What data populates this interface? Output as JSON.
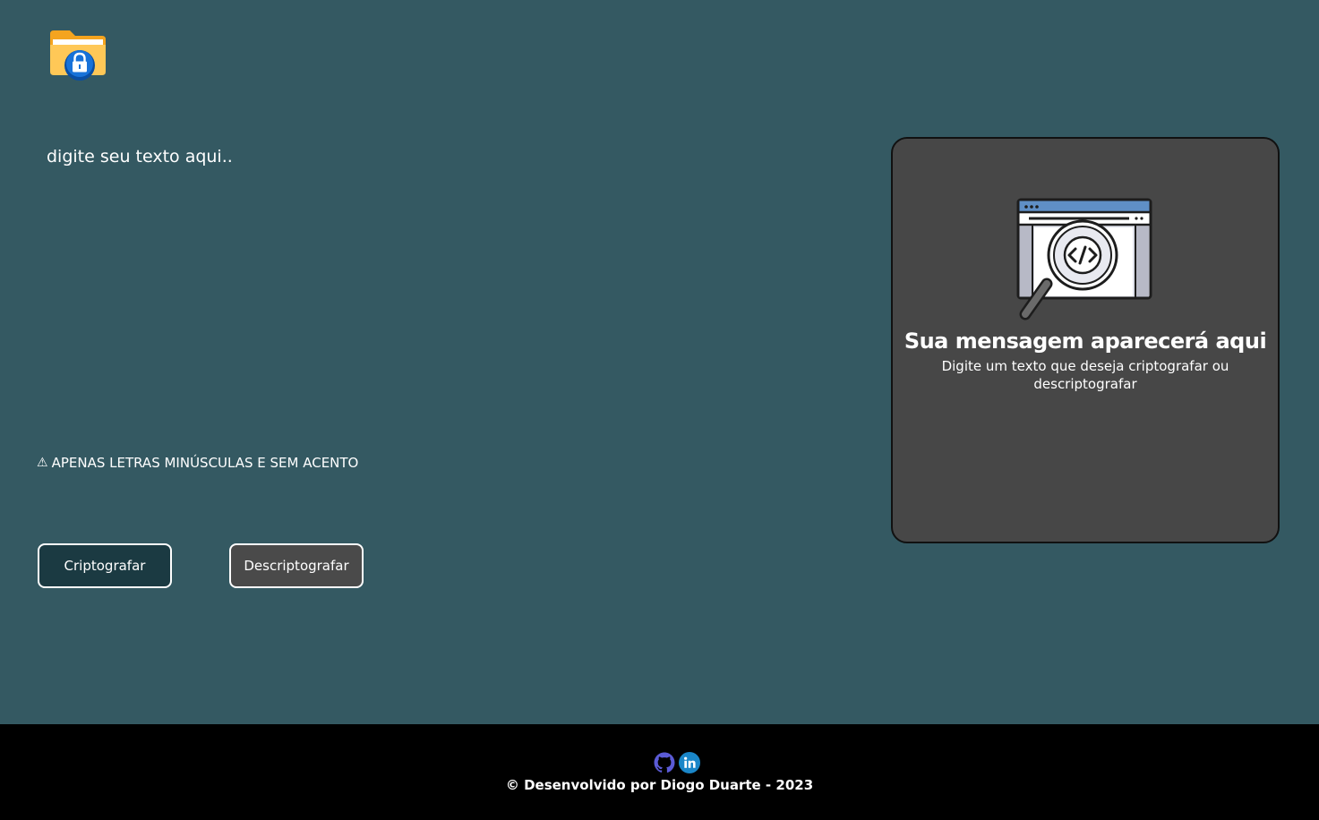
{
  "logo": {
    "icon": "locked-folder-icon"
  },
  "input": {
    "placeholder": "digite seu texto aqui..",
    "value": ""
  },
  "warning": {
    "icon": "warning-icon",
    "symbol": "⚠",
    "text": "APENAS LETRAS MINÚSCULAS E SEM ACENTO"
  },
  "buttons": {
    "encrypt_label": "Criptografar",
    "decrypt_label": "Descriptografar"
  },
  "output": {
    "illustration": "code-search-icon",
    "title": "Sua mensagem aparecerá aqui",
    "subtitle": "Digite um texto que deseja criptografar ou descriptografar"
  },
  "footer": {
    "icons": [
      "github-icon",
      "linkedin-icon"
    ],
    "credit": "© Desenvolvido por Diogo Duarte - 2023"
  },
  "colors": {
    "background": "#345962",
    "panel": "#474747",
    "encrypt_button": "#1b3a42",
    "decrypt_button": "#4a4a4a",
    "footer": "#000000"
  }
}
